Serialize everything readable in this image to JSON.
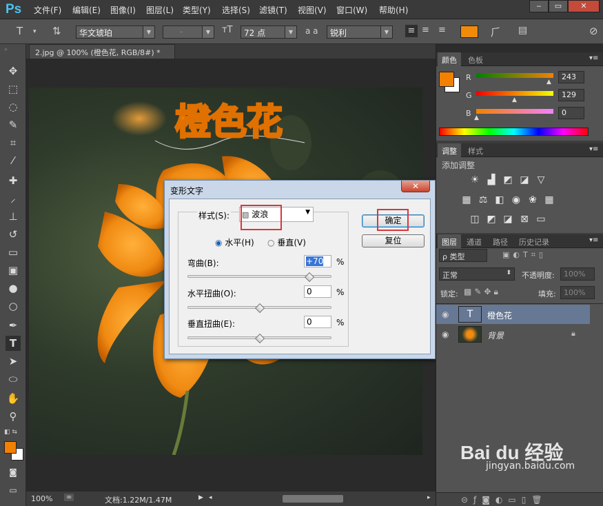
{
  "app": {
    "logo": "Ps"
  },
  "menu": [
    "文件(F)",
    "编辑(E)",
    "图像(I)",
    "图层(L)",
    "类型(Y)",
    "选择(S)",
    "滤镜(T)",
    "视图(V)",
    "窗口(W)",
    "帮助(H)"
  ],
  "options": {
    "font_family": "华文琥珀",
    "font_style": "-",
    "font_size": "72 点",
    "aa_icon": "a a",
    "antialias": "锐利",
    "text_color": "#f08a0a"
  },
  "document": {
    "tab_title": "2.jpg @ 100% (橙色花, RGB/8#) *",
    "close": "×",
    "headline": "橙色花"
  },
  "status": {
    "zoom": "100%",
    "doc_info": "文档:1.22M/1.47M"
  },
  "dialog": {
    "title": "变形文字",
    "close": "✕",
    "style_label": "样式(S):",
    "style_value": "波浪",
    "horizontal": "水平(H)",
    "vertical": "垂直(V)",
    "bend_label": "弯曲(B):",
    "bend_value": "+70",
    "hdist_label": "水平扭曲(O):",
    "hdist_value": "0",
    "vdist_label": "垂直扭曲(E):",
    "vdist_value": "0",
    "percent": "%",
    "ok": "确定",
    "reset": "复位"
  },
  "color_panel": {
    "tabs": [
      "颜色",
      "色板"
    ],
    "channels": [
      {
        "name": "R",
        "value": "243"
      },
      {
        "name": "G",
        "value": "129"
      },
      {
        "name": "B",
        "value": "0"
      }
    ],
    "foreground": "#f38100"
  },
  "adjust_panel": {
    "tabs": [
      "调整",
      "样式"
    ],
    "heading": "添加调整"
  },
  "layers_panel": {
    "tabs": [
      "图层",
      "通道",
      "路径",
      "历史记录"
    ],
    "filter": "ρ 类型",
    "blend_mode": "正常",
    "opacity_label": "不透明度:",
    "opacity_value": "100%",
    "lock_label": "锁定:",
    "fill_label": "填充:",
    "fill_value": "100%",
    "layers": [
      {
        "name": "橙色花",
        "kind": "T"
      },
      {
        "name": "背景",
        "kind": "img"
      }
    ]
  },
  "watermark": {
    "brand": "Bai du 经验",
    "url": "jingyan.baidu.com"
  }
}
